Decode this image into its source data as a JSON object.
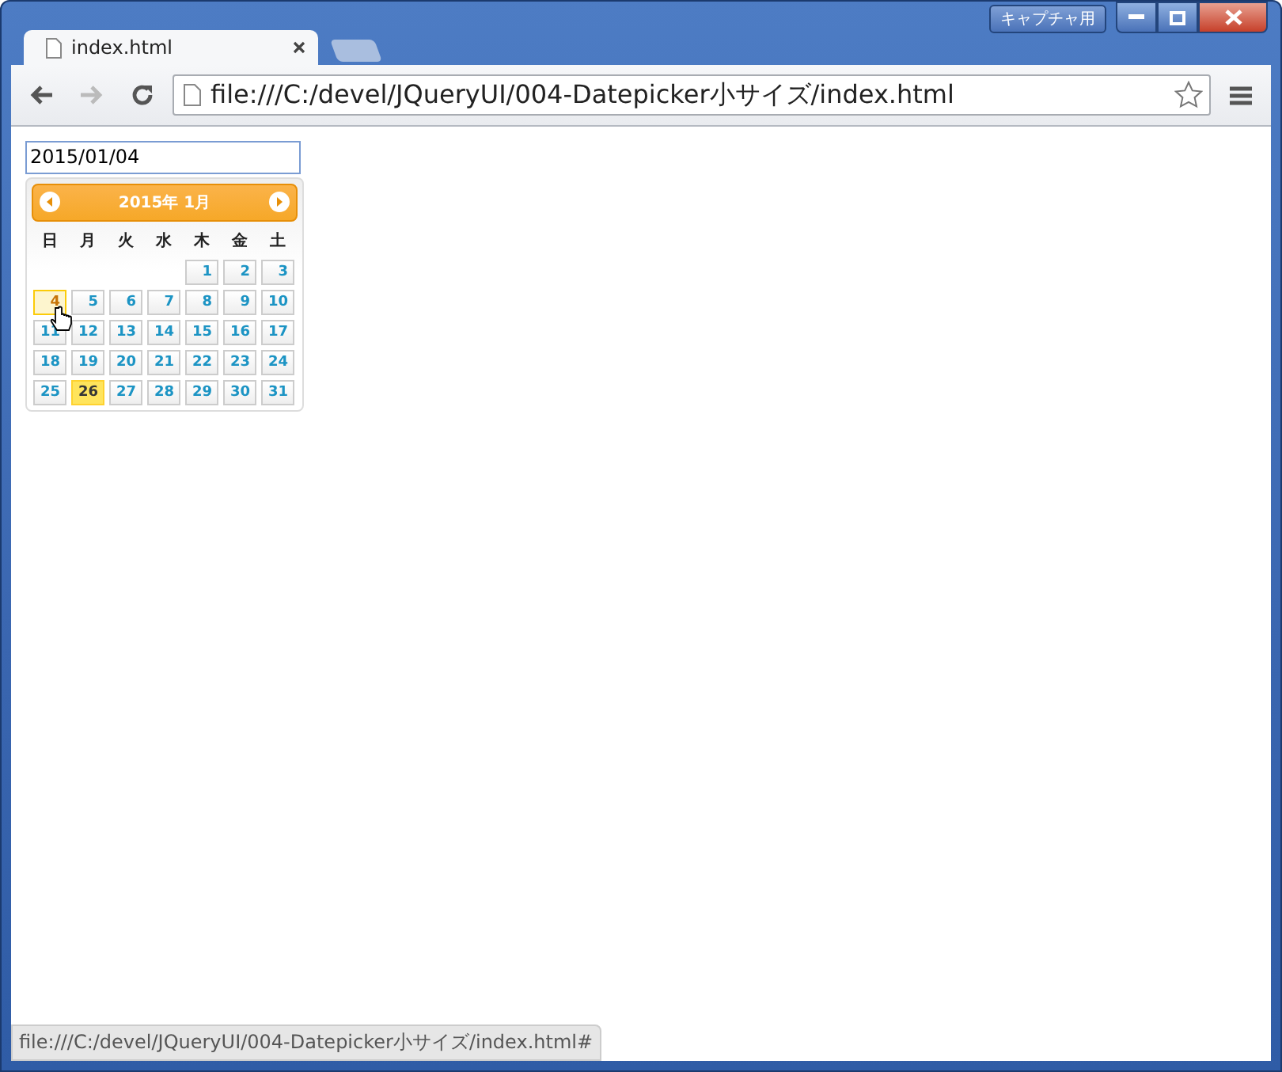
{
  "window": {
    "capture_button": "キャプチャ用"
  },
  "tabs": [
    {
      "title": "index.html",
      "selected": true
    }
  ],
  "address_bar": {
    "url": "file:///C:/devel/JQueryUI/004-Datepicker小サイズ/index.html"
  },
  "page": {
    "date_field": {
      "value": "2015/01/04"
    },
    "datepicker": {
      "title": "2015年 1月",
      "weekdays": [
        "日",
        "月",
        "火",
        "水",
        "木",
        "金",
        "土"
      ],
      "weeks": [
        [
          {
            "label": "1",
            "selected": false,
            "today": false
          },
          {
            "label": "2",
            "selected": false,
            "today": false
          },
          {
            "label": "3",
            "selected": false,
            "today": false
          }
        ],
        [
          {
            "label": "4",
            "selected": true,
            "today": false
          },
          {
            "label": "5",
            "selected": false,
            "today": false
          },
          {
            "label": "6",
            "selected": false,
            "today": false
          },
          {
            "label": "7",
            "selected": false,
            "today": false
          },
          {
            "label": "8",
            "selected": false,
            "today": false
          },
          {
            "label": "9",
            "selected": false,
            "today": false
          },
          {
            "label": "10",
            "selected": false,
            "today": false
          }
        ],
        [
          {
            "label": "11",
            "selected": false,
            "today": false
          },
          {
            "label": "12",
            "selected": false,
            "today": false
          },
          {
            "label": "13",
            "selected": false,
            "today": false
          },
          {
            "label": "14",
            "selected": false,
            "today": false
          },
          {
            "label": "15",
            "selected": false,
            "today": false
          },
          {
            "label": "16",
            "selected": false,
            "today": false
          },
          {
            "label": "17",
            "selected": false,
            "today": false
          }
        ],
        [
          {
            "label": "18",
            "selected": false,
            "today": false
          },
          {
            "label": "19",
            "selected": false,
            "today": false
          },
          {
            "label": "20",
            "selected": false,
            "today": false
          },
          {
            "label": "21",
            "selected": false,
            "today": false
          },
          {
            "label": "22",
            "selected": false,
            "today": false
          },
          {
            "label": "23",
            "selected": false,
            "today": false
          },
          {
            "label": "24",
            "selected": false,
            "today": false
          }
        ],
        [
          {
            "label": "25",
            "selected": false,
            "today": false
          },
          {
            "label": "26",
            "selected": false,
            "today": true
          },
          {
            "label": "27",
            "selected": false,
            "today": false
          },
          {
            "label": "28",
            "selected": false,
            "today": false
          },
          {
            "label": "29",
            "selected": false,
            "today": false
          },
          {
            "label": "30",
            "selected": false,
            "today": false
          },
          {
            "label": "31",
            "selected": false,
            "today": false
          }
        ]
      ]
    }
  },
  "status_bar": {
    "text": "file:///C:/devel/JQueryUI/004-Datepicker小サイズ/index.html#"
  }
}
